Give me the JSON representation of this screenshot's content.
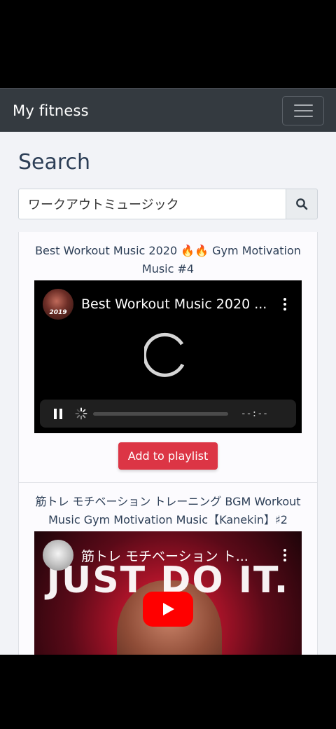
{
  "navbar": {
    "brand": "My fitness"
  },
  "page": {
    "title": "Search"
  },
  "search": {
    "value": "ワークアウトミュージック",
    "button_icon": "search-icon"
  },
  "results": [
    {
      "title": "Best Workout Music 2020 🔥🔥 Gym Motivation Music #4",
      "player_title": "Best Workout Music 2020 ...",
      "avatar_text": "2019",
      "time": "--:--",
      "button_label": "Add to playlist"
    },
    {
      "title": "筋トレ モチベーション トレーニング BGM Workout Music Gym Motivation Music【Kanekin】♯2",
      "player_title": "筋トレ モチベーション ト...",
      "thumbnail_text": "JUST DO IT."
    }
  ],
  "colors": {
    "navbar": "#343a40",
    "background": "#f2f3f7",
    "title": "#2c3e56",
    "accent_button": "#dc3545",
    "youtube_red": "#ff0000"
  }
}
